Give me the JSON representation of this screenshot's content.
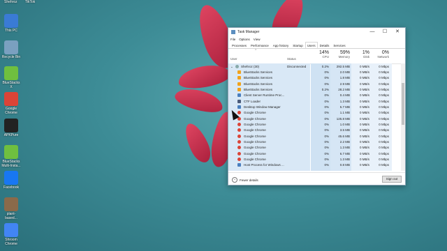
{
  "desktop": {
    "top_labels": [
      "Shehroz",
      "TikTok"
    ],
    "icons": [
      {
        "label": "This PC",
        "icon": "computer-icon",
        "color": "#3a7bd5"
      },
      {
        "label": "Recycle Bin",
        "icon": "recycle-bin-icon",
        "color": "#7aa0c0"
      },
      {
        "label": "BlueStacks X",
        "icon": "bluestacks-icon",
        "color": "#6fbf3f"
      },
      {
        "label": "Google Chrome",
        "icon": "chrome-icon",
        "color": "#db4437"
      },
      {
        "label": "APKPure",
        "icon": "apkpure-icon",
        "color": "#222222"
      },
      {
        "label": "BlueStacks Multi-Insta...",
        "icon": "bluestacks-multi-icon",
        "color": "#6fbf3f"
      },
      {
        "label": "Facebook",
        "icon": "facebook-icon",
        "color": "#1877f2"
      },
      {
        "label": "plant-based...",
        "icon": "image-file-icon",
        "color": "#8a6a4a"
      },
      {
        "label": "Shroom Chrome",
        "icon": "chrome-shortcut-icon",
        "color": "#4285f4"
      }
    ]
  },
  "window": {
    "title": "Task Manager",
    "controls": {
      "minimize": "—",
      "maximize": "☐",
      "close": "✕"
    },
    "menu": [
      "File",
      "Options",
      "View"
    ],
    "tabs": [
      "Processes",
      "Performance",
      "App history",
      "Startup",
      "Users",
      "Details",
      "Services"
    ],
    "active_tab": "Users",
    "columns": {
      "user": "User",
      "status": "Status",
      "cpu": {
        "pct": "14%",
        "label": "CPU"
      },
      "memory": {
        "pct": "59%",
        "label": "Memory"
      },
      "disk": {
        "pct": "1%",
        "label": "Disk"
      },
      "network": {
        "pct": "0%",
        "label": "Network"
      }
    },
    "user_row": {
      "name": "Shehroz (30)",
      "status": "Disconnected",
      "cpu": "0.2%",
      "mem": "292.5 MB",
      "disk": "0 MB/s",
      "net": "0 Mbps"
    },
    "processes": [
      {
        "name": "BlueStacks Services",
        "cpu": "0%",
        "mem": "2.0 MB",
        "disk": "0 MB/s",
        "net": "0 Mbps",
        "icon": "bluestacks"
      },
      {
        "name": "BlueStacks Services",
        "cpu": "0%",
        "mem": "1.8 MB",
        "disk": "0 MB/s",
        "net": "0 Mbps",
        "icon": "bluestacks"
      },
      {
        "name": "BlueStacks Services",
        "cpu": "0%",
        "mem": "2.9 MB",
        "disk": "0 MB/s",
        "net": "0 Mbps",
        "icon": "bluestacks"
      },
      {
        "name": "BlueStacks Services",
        "cpu": "0.2%",
        "mem": "28.2 MB",
        "disk": "0 MB/s",
        "net": "0 Mbps",
        "icon": "bluestacks"
      },
      {
        "name": "Client Server Runtime Proc...",
        "cpu": "0%",
        "mem": "0.4 MB",
        "disk": "0 MB/s",
        "net": "0 Mbps",
        "icon": "system"
      },
      {
        "name": "CTF Loader",
        "cpu": "0%",
        "mem": "1.3 MB",
        "disk": "0 MB/s",
        "net": "0 Mbps",
        "icon": "ctf"
      },
      {
        "name": "Desktop Window Manager",
        "cpu": "0%",
        "mem": "5.7 MB",
        "disk": "0 MB/s",
        "net": "0 Mbps",
        "icon": "system"
      },
      {
        "name": "Google Chrome",
        "cpu": "0%",
        "mem": "1.1 MB",
        "disk": "0 MB/s",
        "net": "0 Mbps",
        "icon": "chrome"
      },
      {
        "name": "Google Chrome",
        "cpu": "0%",
        "mem": "125.8 MB",
        "disk": "0 MB/s",
        "net": "0 Mbps",
        "icon": "chrome"
      },
      {
        "name": "Google Chrome",
        "cpu": "0%",
        "mem": "1.0 MB",
        "disk": "0 MB/s",
        "net": "0 Mbps",
        "icon": "chrome"
      },
      {
        "name": "Google Chrome",
        "cpu": "0%",
        "mem": "3.5 MB",
        "disk": "0 MB/s",
        "net": "0 Mbps",
        "icon": "chrome"
      },
      {
        "name": "Google Chrome",
        "cpu": "0%",
        "mem": "45.6 MB",
        "disk": "0 MB/s",
        "net": "0 Mbps",
        "icon": "chrome"
      },
      {
        "name": "Google Chrome",
        "cpu": "0%",
        "mem": "2.2 MB",
        "disk": "0 MB/s",
        "net": "0 Mbps",
        "icon": "chrome"
      },
      {
        "name": "Google Chrome",
        "cpu": "0%",
        "mem": "1.3 MB",
        "disk": "0 MB/s",
        "net": "0 Mbps",
        "icon": "chrome"
      },
      {
        "name": "Google Chrome",
        "cpu": "0%",
        "mem": "6.7 MB",
        "disk": "0 MB/s",
        "net": "0 Mbps",
        "icon": "chrome"
      },
      {
        "name": "Google Chrome",
        "cpu": "0%",
        "mem": "1.3 MB",
        "disk": "0 MB/s",
        "net": "0 Mbps",
        "icon": "chrome"
      },
      {
        "name": "Host Process for Windows ...",
        "cpu": "0%",
        "mem": "0.8 MB",
        "disk": "0 MB/s",
        "net": "0 Mbps",
        "icon": "system"
      }
    ],
    "footer": {
      "fewer_details": "Fewer details",
      "sign_out": "Sign out"
    }
  }
}
